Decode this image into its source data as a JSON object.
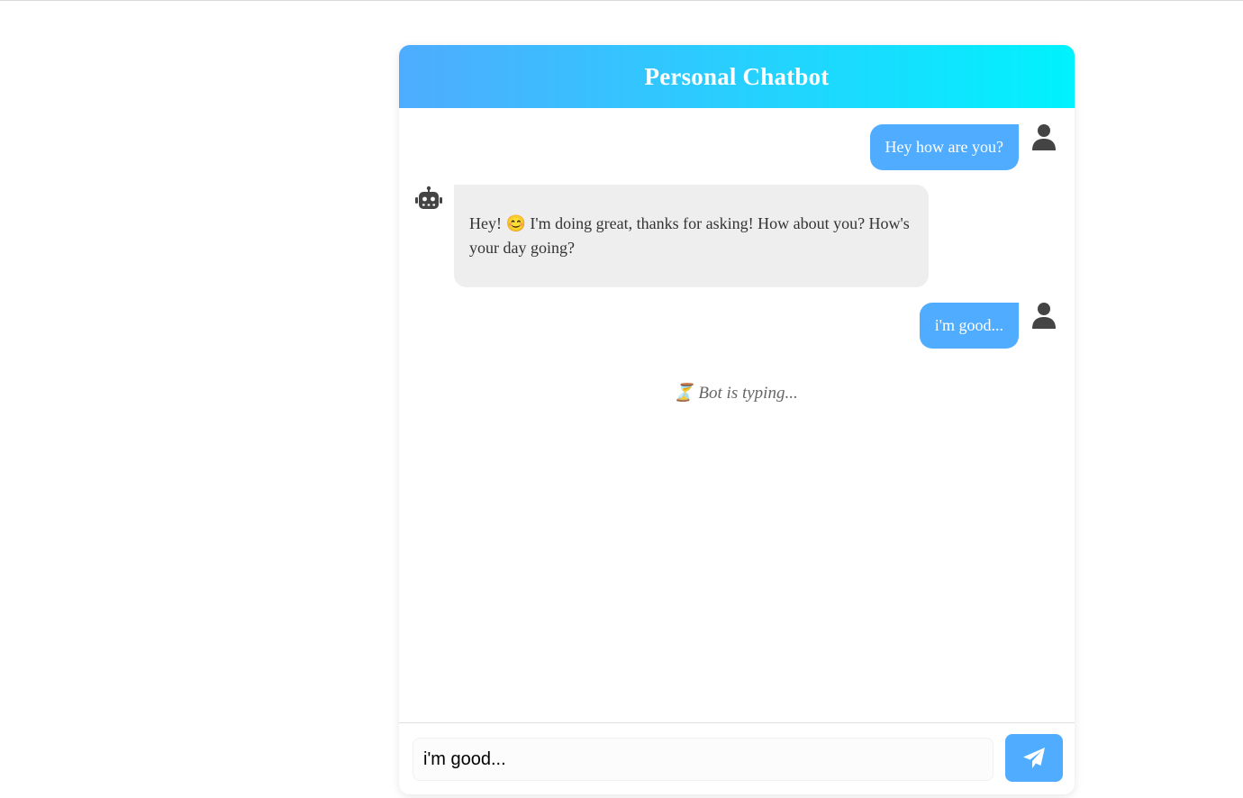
{
  "header": {
    "title": "Personal Chatbot"
  },
  "messages": [
    {
      "sender": "user",
      "text": "Hey how are you?",
      "avatar_icon": "user-icon"
    },
    {
      "sender": "bot",
      "text": "Hey! 😊 I'm doing great, thanks for asking! How about you? How's your day going?",
      "avatar_icon": "robot-icon"
    },
    {
      "sender": "user",
      "text": "i'm good...",
      "avatar_icon": "user-icon"
    }
  ],
  "typing_indicator": {
    "text": "⏳ Bot is typing..."
  },
  "composer": {
    "value": "i'm good...",
    "send_icon": "paper-plane-icon"
  },
  "colors": {
    "header_gradient_start": "#4facfe",
    "header_gradient_end": "#00f2fe",
    "user_bubble": "#4facfe",
    "bot_bubble": "#eeeeee",
    "avatar": "#444444"
  }
}
